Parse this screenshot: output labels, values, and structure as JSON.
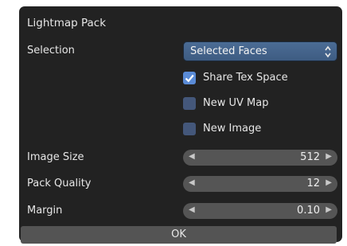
{
  "dialog": {
    "title": "Lightmap Pack",
    "selection": {
      "label": "Selection",
      "value": "Selected Faces"
    },
    "options": [
      {
        "label": "Share Tex Space",
        "checked": true
      },
      {
        "label": "New UV Map",
        "checked": false
      },
      {
        "label": "New Image",
        "checked": false
      }
    ],
    "fields": [
      {
        "label": "Image Size",
        "value": "512"
      },
      {
        "label": "Pack Quality",
        "value": "12"
      },
      {
        "label": "Margin",
        "value": "0.10"
      }
    ],
    "ok_label": "OK"
  },
  "colors": {
    "background": "#222222",
    "accent": "#5a8bd6",
    "dropdown": "#4b6c95",
    "field": "#555555"
  },
  "icons": {
    "dropdown": "up-down-chevron-icon",
    "decrement": "left-arrow-icon",
    "increment": "right-arrow-icon",
    "check": "check-icon"
  }
}
